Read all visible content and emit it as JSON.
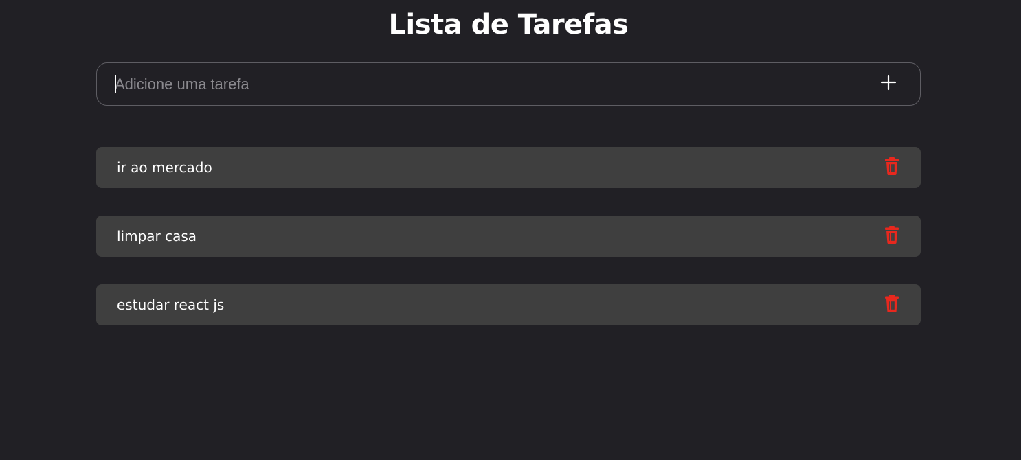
{
  "header": {
    "title": "Lista de Tarefas"
  },
  "add_form": {
    "placeholder": "Adicione uma tarefa",
    "value": "",
    "add_icon": "plus-icon"
  },
  "tasks": [
    {
      "text": "ir ao mercado",
      "delete_icon": "trash-icon"
    },
    {
      "text": "limpar casa",
      "delete_icon": "trash-icon"
    },
    {
      "text": "estudar react js",
      "delete_icon": "trash-icon"
    }
  ],
  "colors": {
    "background": "#212025",
    "task_background": "#3f3f3f",
    "input_border": "#5e5d63",
    "placeholder": "#8a898e",
    "delete_red": "#e8281e",
    "text": "#ffffff"
  }
}
